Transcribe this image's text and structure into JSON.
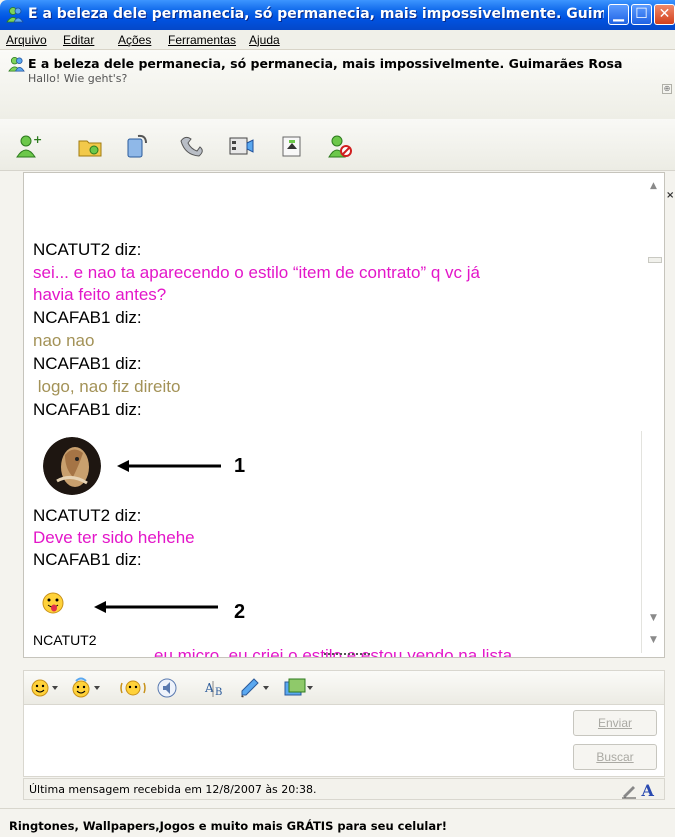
{
  "window": {
    "title": "E a beleza dele permanecia, só permanecia, mais impossivelmente. Guimarã...",
    "controls": {
      "minimize": "minimize-icon",
      "maximize": "maximize-icon",
      "close": "close-icon"
    }
  },
  "menu": [
    "Arquivo",
    "Editar",
    "Ações",
    "Ferramentas",
    "Ajuda"
  ],
  "contact": {
    "title": "E a beleza dele permanecia, só permanecia, mais impossivelmente. Guimarães Rosa",
    "subtitle": "Hallo! Wie geht's?"
  },
  "toolbar_icons": [
    "invite-contact-icon",
    "send-files-icon",
    "voice-call-icon",
    "phone-icon",
    "video-icon",
    "share-activity-icon",
    "block-contact-icon"
  ],
  "chat": {
    "messages": [
      {
        "sender": "NCATUT2 diz:",
        "lines": [
          "sei... e nao ta aparecendo o estilo “item de contrato” q vc já",
          "havia feito antes?"
        ],
        "color": "#e316c9"
      },
      {
        "sender": "NCAFAB1 diz:",
        "lines": [
          "nao nao"
        ],
        "color": "#a39257"
      },
      {
        "sender": "NCAFAB1 diz:",
        "lines": [
          " logo, nao fiz direito"
        ],
        "color": "#a39257"
      },
      {
        "sender": "NCAFAB1 diz:",
        "lines": []
      },
      {
        "sender": "NCATUT2 diz:",
        "lines": [
          "Deve ter sido hehehe"
        ],
        "color": "#e316c9"
      },
      {
        "sender": "NCAFAB1 diz:",
        "lines": []
      }
    ],
    "partial_sender": "NCATUT2",
    "partial_text": "eu micro, eu criei o estilo e estou vendo na lista",
    "annotations": [
      "1",
      "2"
    ]
  },
  "input_toolbar_icons": [
    "emoticon-icon",
    "wink-icon",
    "nudge-icon",
    "voice-clip-icon",
    "font-icon",
    "background-brush-icon",
    "image-icon"
  ],
  "buttons": {
    "send": "Enviar",
    "search": "Buscar"
  },
  "status": {
    "last_message": "Última mensagem recebida em 12/8/2007 às 20:38."
  },
  "ad": {
    "text": "Ringtones, Wallpapers,Jogos e muito mais GRÁTIS para seu celular!"
  }
}
